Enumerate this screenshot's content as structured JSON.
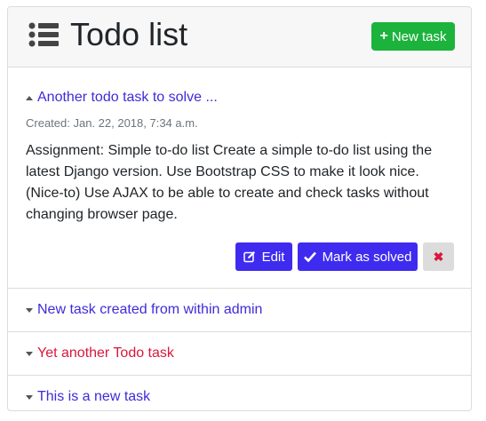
{
  "header": {
    "title": "Todo list",
    "title_icon": "list-icon",
    "new_task_label": "New task",
    "new_task_icon": "plus-icon"
  },
  "tasks": [
    {
      "title": "Another todo task to solve ...",
      "expanded": true,
      "created": "Created: Jan. 22, 2018, 7:34 a.m.",
      "description": "Assignment: Simple to-do list Create a simple to-do list using the latest Django version. Use Bootstrap CSS to make it look nice. (Nice-to) Use AJAX to be able to create and check tasks without changing browser page.",
      "edit_label": "Edit",
      "solve_label": "Mark as solved"
    },
    {
      "title": "New task created from within admin",
      "expanded": false,
      "color": "#3f2bd8"
    },
    {
      "title": "Yet another Todo task",
      "expanded": false,
      "color": "#d8183c"
    },
    {
      "title": "This is a new task",
      "expanded": false,
      "color": "#3f2bd8"
    }
  ],
  "colors": {
    "accent": "#3f2bf0",
    "success": "#1cb33c",
    "danger": "#d8183c"
  }
}
